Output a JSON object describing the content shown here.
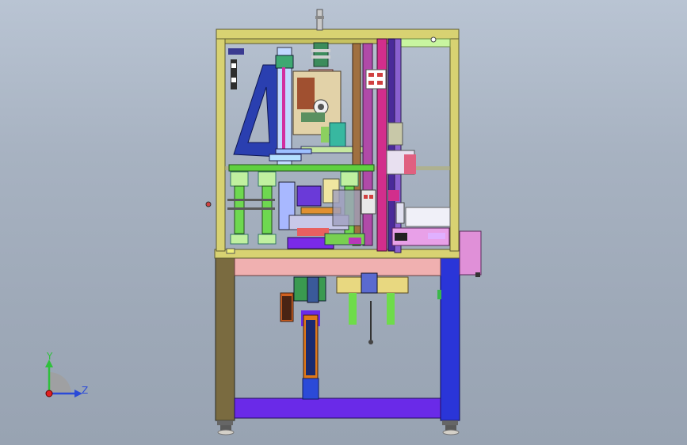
{
  "triad": {
    "y_label": "Y",
    "z_label": "Z"
  },
  "colors": {
    "frame_yellow": "#d8d272",
    "frame_olive": "#7a6b40",
    "blue": "#2a35d8",
    "purple": "#7a2ae8",
    "pink": "#d48ad8",
    "green": "#7be04a",
    "orange": "#e6781c",
    "background": "#a9b4c3"
  }
}
